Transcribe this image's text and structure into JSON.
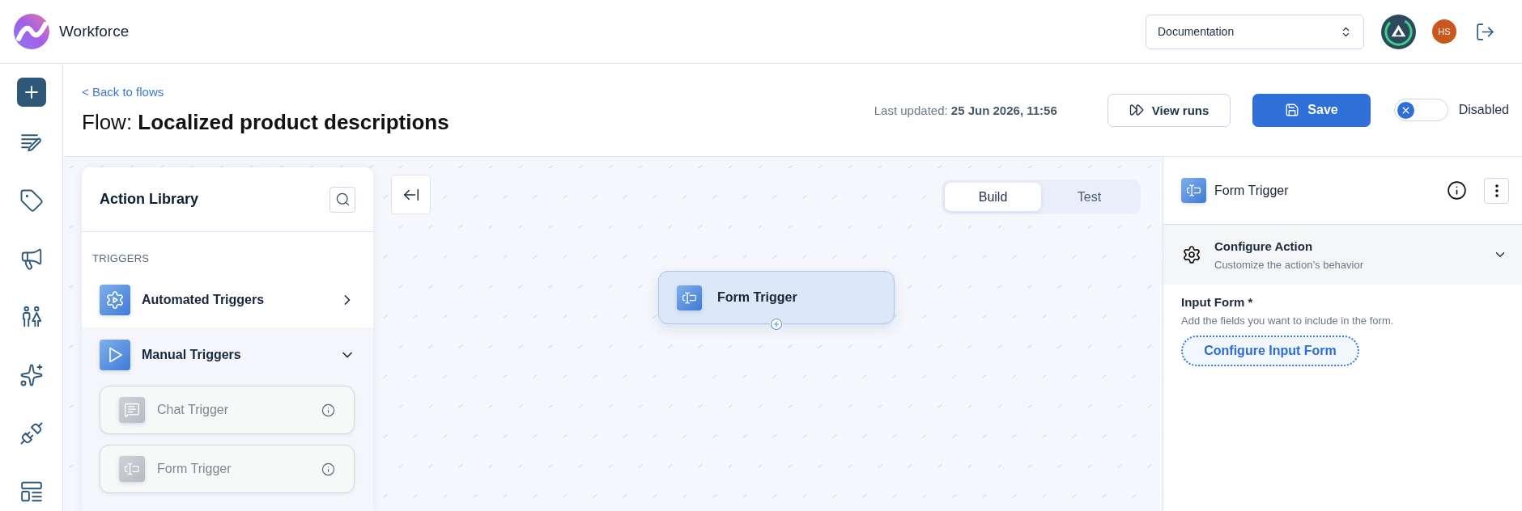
{
  "app": {
    "name": "Workforce"
  },
  "header": {
    "workspace_select": {
      "value": "Documentation"
    },
    "user_avatar": {
      "initials": "HS"
    }
  },
  "page_header": {
    "back_link": "< Back to flows",
    "title": "Flow: **Localized product descriptions**",
    "last_updated": "Last updated: **25 Jun 2026, 11:56**",
    "buttons": [
      {
        "kind": "view_runs",
        "label": "View runs"
      },
      {
        "kind": "save",
        "label": "Save"
      }
    ],
    "status_toggle": {
      "on": false,
      "label": "Disabled"
    }
  },
  "action_library": {
    "title": "Action Library",
    "sections": [
      {
        "heading": "TRIGGERS",
        "groups": [
          {
            "kind": "automated",
            "label": "Automated Triggers",
            "expanded": false
          },
          {
            "kind": "manual",
            "label": "Manual Triggers",
            "expanded": true,
            "children": [
              {
                "kind": "chat",
                "label": "Chat Trigger",
                "disabled": true
              },
              {
                "kind": "form",
                "label": "Form Trigger",
                "disabled": true
              }
            ]
          }
        ]
      }
    ]
  },
  "canvas": {
    "mode_tabs": [
      {
        "label": "Build",
        "selected": true
      },
      {
        "label": "Test",
        "selected": false
      }
    ],
    "nodes": [
      {
        "kind": "form",
        "label": "Form Trigger",
        "selected": true
      }
    ]
  },
  "details_panel": {
    "kind": "form",
    "title": "Form Trigger",
    "section": {
      "title": "Configure Action",
      "subtitle": "Customize the action’s behavior",
      "expanded": true
    },
    "field": {
      "label": "Input Form *",
      "help": "Add the fields you want to include in the form.",
      "button": "Configure Input Form"
    }
  }
}
